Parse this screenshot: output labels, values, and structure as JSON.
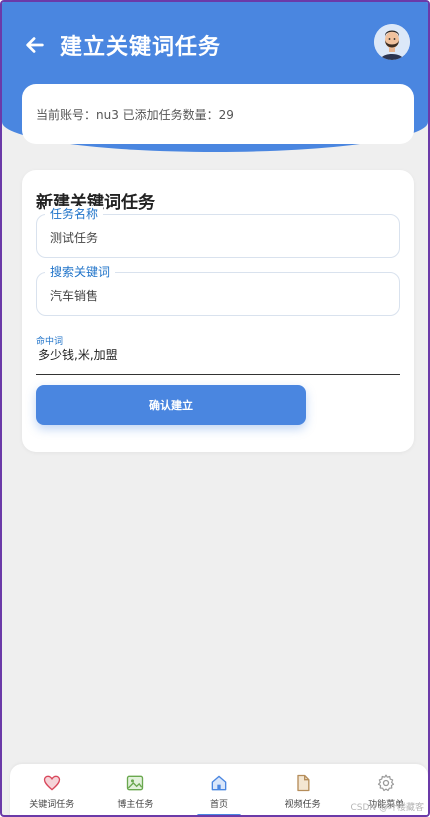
{
  "header": {
    "title": "建立关键词任务"
  },
  "account": {
    "text": "当前账号：nu3 已添加任务数量：29"
  },
  "form": {
    "title": "新建关键词任务",
    "task_name": {
      "label": "任务名称",
      "value": "测试任务"
    },
    "search_keyword": {
      "label": "搜索关键词",
      "value": "汽车销售"
    },
    "hit_words": {
      "label": "命中词",
      "value": "多少钱,米,加盟"
    },
    "confirm_label": "确认建立"
  },
  "nav": {
    "items": [
      {
        "label": "关键词任务",
        "icon": "heart-icon"
      },
      {
        "label": "博主任务",
        "icon": "image-icon"
      },
      {
        "label": "首页",
        "icon": "home-icon"
      },
      {
        "label": "视频任务",
        "icon": "file-icon"
      },
      {
        "label": "功能菜单",
        "icon": "gear-icon"
      }
    ],
    "active_index": 2
  },
  "watermark": "CSDN @叶楼藏客",
  "colors": {
    "primary": "#4a86e0",
    "background": "#efefef",
    "frame": "#6b3aa8",
    "label_blue": "#1f73c9"
  }
}
